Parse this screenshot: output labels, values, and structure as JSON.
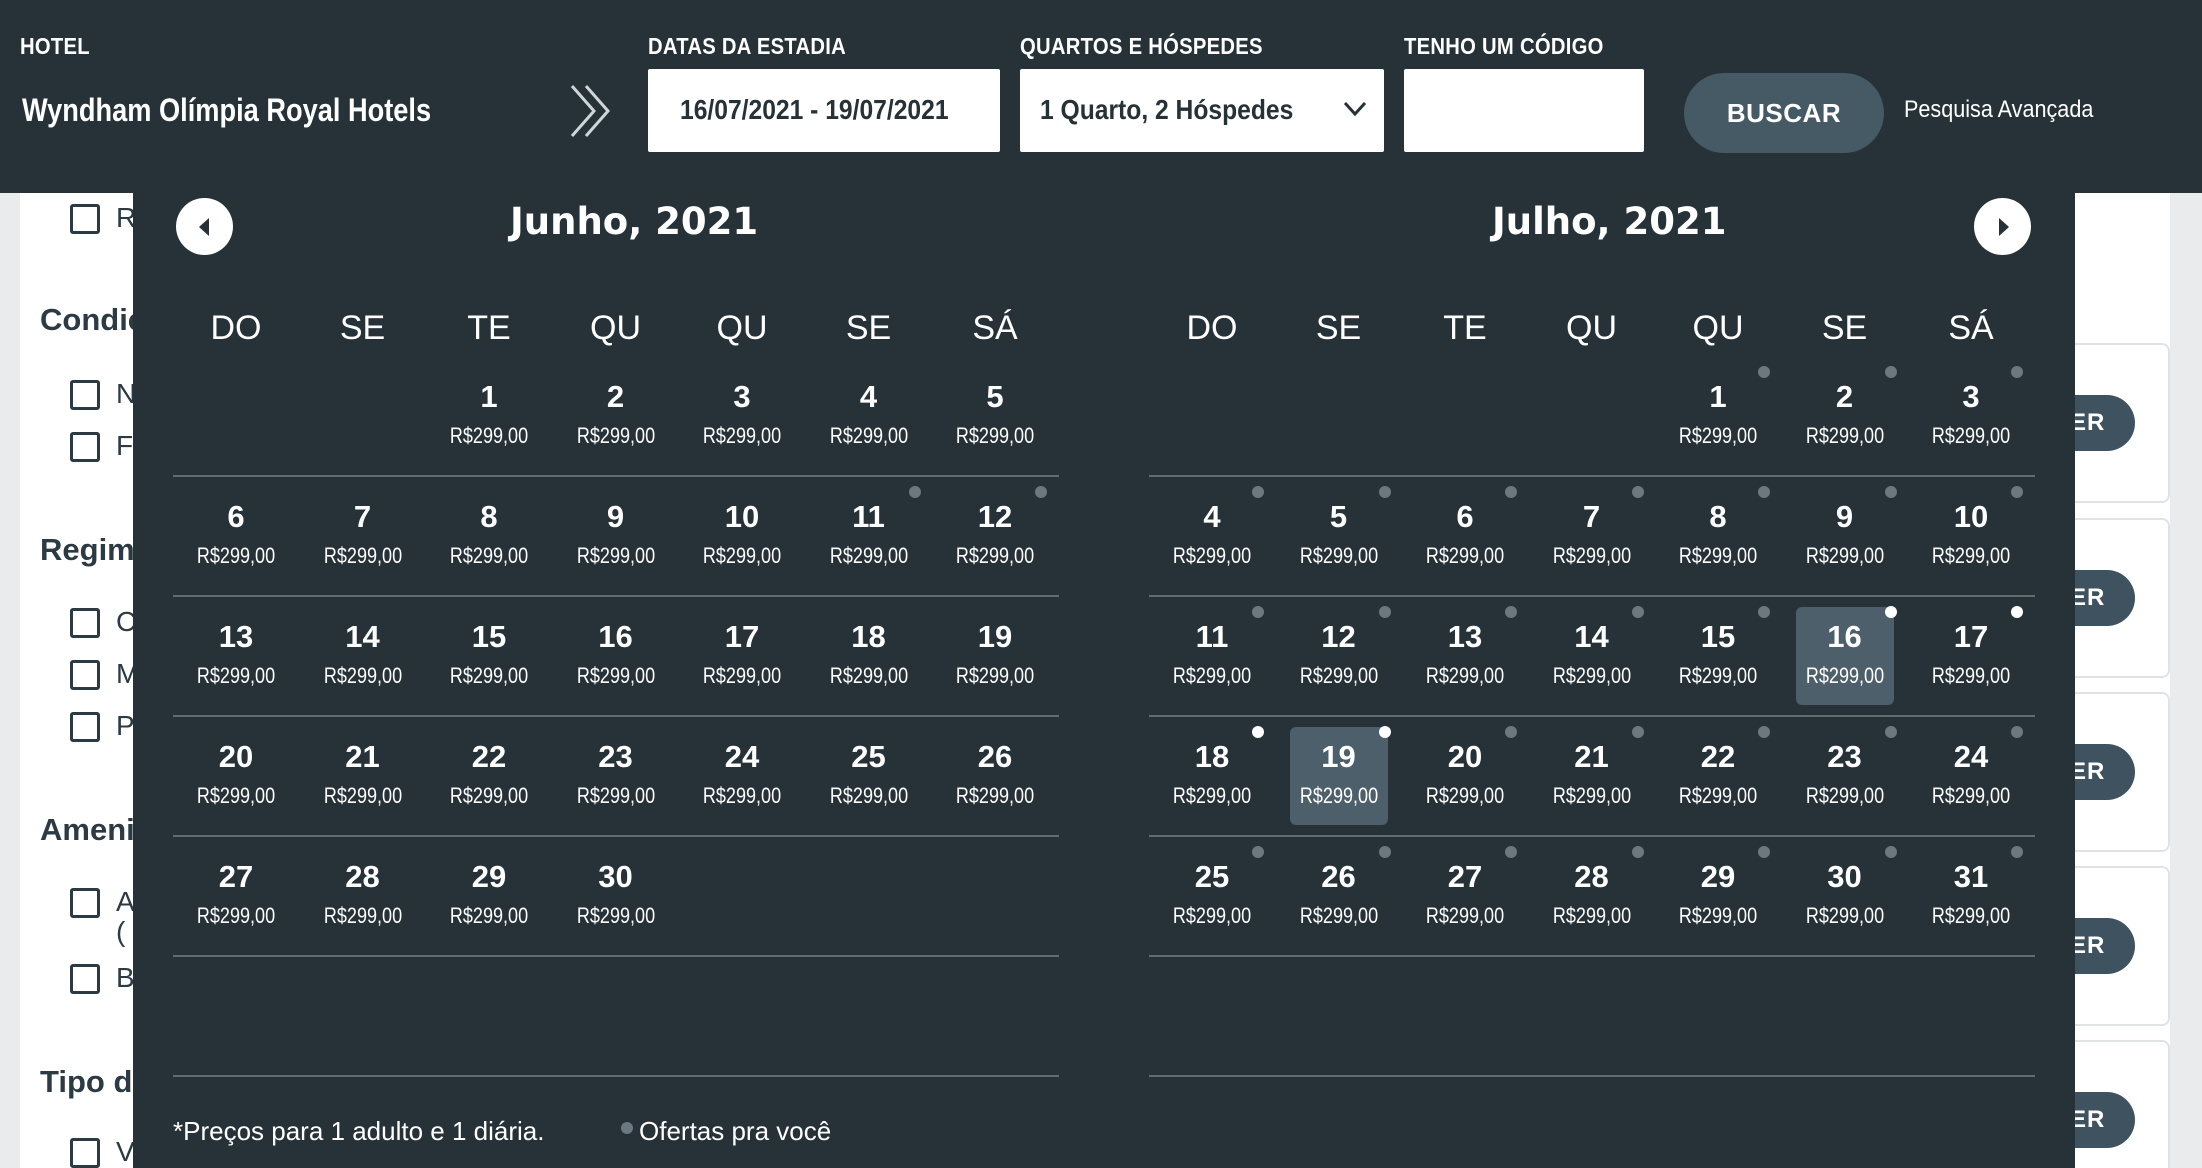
{
  "header": {
    "hotel_label": "HOTEL",
    "hotel_name": "Wyndham Olímpia Royal Hotels",
    "dates_label": "DATAS DA ESTADIA",
    "dates_value": "16/07/2021 - 19/07/2021",
    "rooms_label": "QUARTOS E HÓSPEDES",
    "rooms_value": "1 Quarto, 2 Hóspedes",
    "code_label": "TENHO UM CÓDIGO",
    "code_value": "",
    "search_button": "BUSCAR",
    "advanced_link": "Pesquisa Avançada"
  },
  "background": {
    "filter_titles": [
      "Condiç",
      "Regim",
      "Ameni",
      "Tipo d"
    ],
    "filter_letters": [
      "R",
      "N",
      "F",
      "C",
      "M",
      "P",
      "A",
      "(",
      "B",
      "V"
    ],
    "result_button_text": "ER"
  },
  "calendar": {
    "weekdays": [
      "DO",
      "SE",
      "TE",
      "QU",
      "QU",
      "SE",
      "SÁ"
    ],
    "months": [
      {
        "title": "Junho, 2021",
        "first_weekday": 2,
        "days": 30,
        "price": "R$299,00",
        "offer_days": [
          11,
          12
        ],
        "selected_days": []
      },
      {
        "title": "Julho, 2021",
        "first_weekday": 4,
        "days": 31,
        "price": "R$299,00",
        "offer_days": [
          1,
          2,
          3,
          4,
          5,
          6,
          7,
          8,
          9,
          10,
          11,
          12,
          13,
          14,
          15,
          16,
          17,
          18,
          19,
          20,
          21,
          22,
          23,
          24,
          25,
          26,
          27,
          28,
          29,
          30,
          31
        ],
        "white_dot_days": [
          16,
          17,
          18,
          19
        ],
        "selected_days": [
          16,
          19
        ],
        "range_days": [
          17,
          18
        ]
      }
    ],
    "footnote": "*Preços para 1 adulto e 1 diária.",
    "legend": "Ofertas pra você"
  },
  "colors": {
    "header_bg": "#263238",
    "selected_bg": "#4d5f6b",
    "button_bg": "#455a64",
    "offer_dot": "#6b7880"
  }
}
